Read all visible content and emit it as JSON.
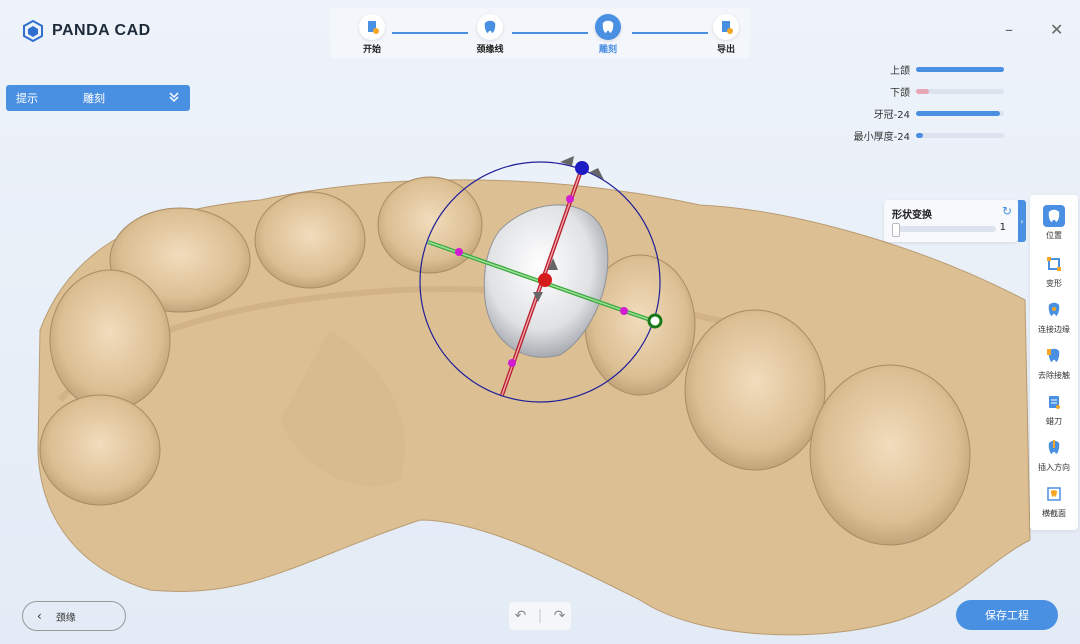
{
  "app": {
    "title": "PANDA CAD"
  },
  "steps": [
    {
      "label": "开始"
    },
    {
      "label": "颈缘线"
    },
    {
      "label": "雕刻"
    },
    {
      "label": "导出"
    }
  ],
  "hint": {
    "label": "提示",
    "value": "雕刻"
  },
  "visibility": [
    {
      "label": "上颌",
      "level": 1.0
    },
    {
      "label": "下颌",
      "level": 0.15
    },
    {
      "label": "牙冠-24",
      "level": 0.95
    },
    {
      "label": "最小厚度-24",
      "level": 0.08
    }
  ],
  "shape_panel": {
    "title": "形状变换",
    "value": "1"
  },
  "tools": [
    {
      "label": "位置"
    },
    {
      "label": "变形"
    },
    {
      "label": "连接边缘"
    },
    {
      "label": "去除接触"
    },
    {
      "label": "蜡刀"
    },
    {
      "label": "插入方向"
    },
    {
      "label": "横截面"
    }
  ],
  "footer": {
    "back_label": "颈缘",
    "save_label": "保存工程"
  },
  "colors": {
    "accent": "#4a90e2",
    "model": "#e2c59c"
  }
}
